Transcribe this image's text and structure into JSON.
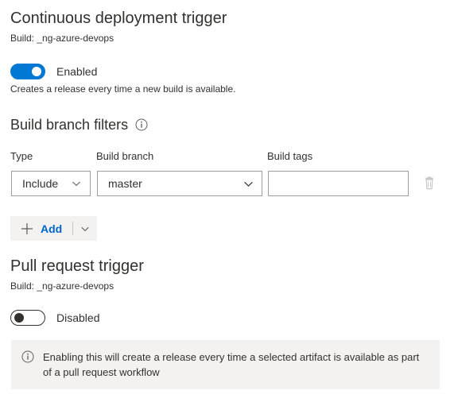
{
  "continuous_deployment": {
    "title": "Continuous deployment trigger",
    "subtitle": "Build: _ng-azure-devops",
    "toggle": {
      "state_label": "Enabled",
      "enabled": true,
      "accent_color": "#0078d4"
    },
    "helper_text": "Creates a release every time a new build is available."
  },
  "build_branch_filters": {
    "title": "Build branch filters",
    "info_icon": "info-circle-icon",
    "columns": [
      "Type",
      "Build branch",
      "Build tags"
    ],
    "rows": [
      {
        "type": "Include",
        "branch": "master",
        "tags": "",
        "tags_placeholder": "",
        "delete_icon": "trash-icon"
      }
    ],
    "add_button": {
      "label": "Add",
      "plus_icon": "plus-icon",
      "caret_icon": "chevron-down-icon",
      "label_color": "#0066cc"
    }
  },
  "pull_request_trigger": {
    "title": "Pull request trigger",
    "subtitle": "Build: _ng-azure-devops",
    "toggle": {
      "state_label": "Disabled",
      "enabled": false
    },
    "message_bar": {
      "icon": "info-circle-icon",
      "text": "Enabling this will create a release every time a selected artifact is available as part of a pull request workflow",
      "background_color": "#f3f2f1"
    }
  }
}
